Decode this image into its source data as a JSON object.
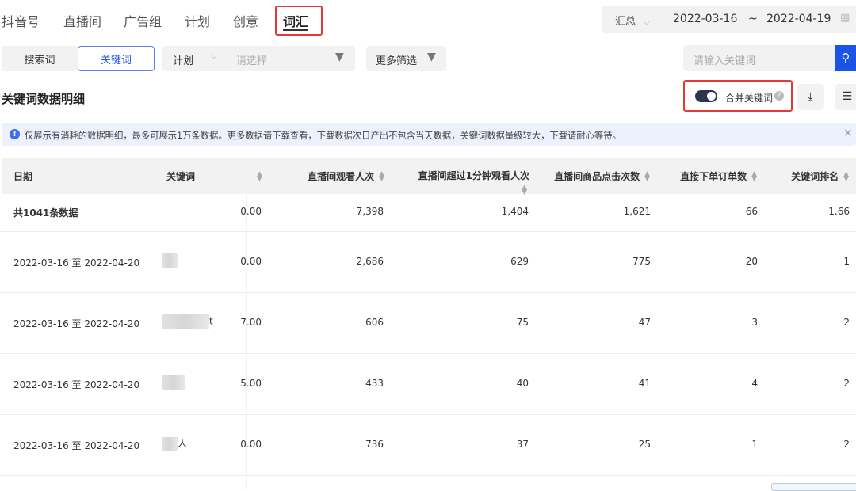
{
  "nav": {
    "tabs": [
      "抖音号",
      "直播间",
      "广告组",
      "计划",
      "创意",
      "词汇"
    ],
    "active": "词汇"
  },
  "date_filter": {
    "mode": "汇总",
    "start": "2022-03-16",
    "separator": "~",
    "end": "2022-04-19"
  },
  "filters": {
    "search_word": "搜索词",
    "keyword": "关键词",
    "plan_label": "计划",
    "plan_placeholder": "请选择",
    "more": "更多筛选",
    "search_placeholder": "请输入关键词"
  },
  "section": {
    "title": "关键词数据明细",
    "merge_label": "合并关键词",
    "merge_on": true
  },
  "notice": "仅展示有消耗的数据明细，最多可展示1万条数据。更多数据请下载查看，下载数据次日产出不包含当天数据，关键词数据量级较大，下载请耐心等待。",
  "table": {
    "headers": [
      "日期",
      "关键词",
      "直播间观看人次",
      "直播间超过1分钟观看人次",
      "直播间商品点击次数",
      "直接下单订单数",
      "关键词排名"
    ],
    "total": {
      "label": "共1041条数据",
      "partial": "0.00",
      "views": "7,398",
      "views_1min": "1,404",
      "clicks": "1,621",
      "orders": "66",
      "rank": "1.66"
    },
    "rows": [
      {
        "date": "2022-03-16 至 2022-04-20",
        "keyword_visible": "",
        "partial": "0.00",
        "views": "2,686",
        "views_1min": "629",
        "clicks": "775",
        "orders": "20",
        "rank": "1"
      },
      {
        "date": "2022-03-16 至 2022-04-20",
        "keyword_visible": "t",
        "partial": "7.00",
        "views": "606",
        "views_1min": "75",
        "clicks": "47",
        "orders": "3",
        "rank": "2"
      },
      {
        "date": "2022-03-16 至 2022-04-20",
        "keyword_visible": "",
        "partial": "5.00",
        "views": "433",
        "views_1min": "40",
        "clicks": "41",
        "orders": "4",
        "rank": "2"
      },
      {
        "date": "2022-03-16 至 2022-04-20",
        "keyword_visible": "人",
        "partial": "0.00",
        "views": "736",
        "views_1min": "37",
        "clicks": "25",
        "orders": "1",
        "rank": "2"
      }
    ]
  },
  "colors": {
    "accent": "#1a53e6",
    "highlight": "#e53935",
    "toggle": "#2b3350"
  }
}
